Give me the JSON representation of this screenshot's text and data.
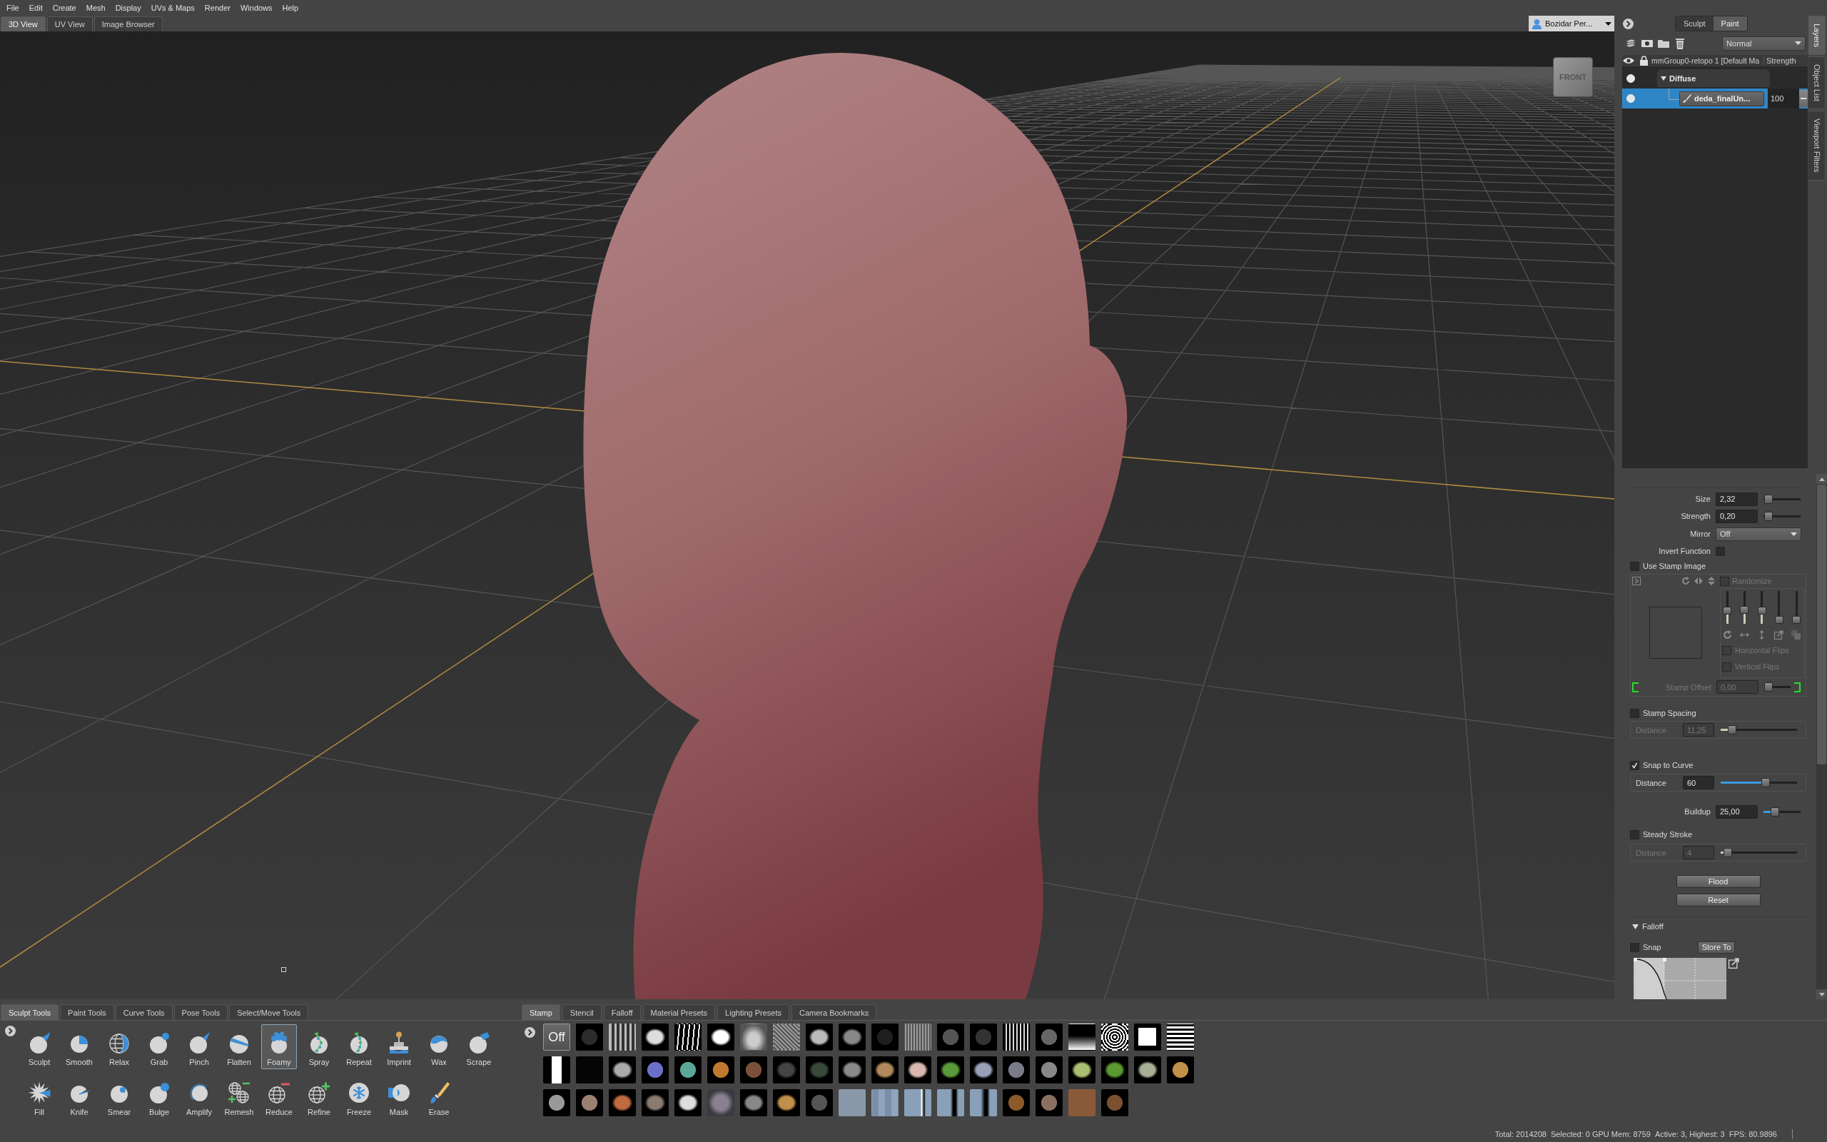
{
  "menu": [
    "File",
    "Edit",
    "Create",
    "Mesh",
    "Display",
    "UVs & Maps",
    "Render",
    "Windows",
    "Help"
  ],
  "view_tabs": [
    {
      "label": "3D View",
      "selected": true
    },
    {
      "label": "UV View",
      "selected": false
    },
    {
      "label": "Image Browser",
      "selected": false
    }
  ],
  "user_menu": {
    "label": "Bozidar Per..."
  },
  "viewport": {
    "view_cube": "FRONT"
  },
  "layers": {
    "mode_tabs": [
      {
        "label": "Sculpt",
        "selected": false
      },
      {
        "label": "Paint",
        "selected": true
      }
    ],
    "blend_mode": "Normal",
    "header": {
      "name": "mmGroup0-retopo 1 [Default Ma",
      "strength": "Strength"
    },
    "items": [
      {
        "name": "Diffuse",
        "visible": true,
        "expanded": true,
        "selected": false,
        "children": [
          {
            "name": "deda_finalUn...",
            "visible": true,
            "strength": "100",
            "selected": true
          }
        ]
      }
    ]
  },
  "side_tabs": [
    {
      "label": "Layers",
      "selected": true
    },
    {
      "label": "Object List",
      "selected": false
    },
    {
      "label": "Viewport Filters",
      "selected": false
    }
  ],
  "brush": {
    "size": {
      "label": "Size",
      "value": "2,32",
      "level": 0.02
    },
    "strength": {
      "label": "Strength",
      "value": "0,20",
      "level": 0.02
    },
    "mirror": {
      "label": "Mirror",
      "value": "Off"
    },
    "invert": {
      "label": "Invert Function",
      "checked": false
    },
    "stamp": {
      "label": "Use Stamp Image",
      "checked": false,
      "randomize": {
        "label": "Randomize",
        "checked": false
      },
      "sliders": [
        {
          "level": 0.35
        },
        {
          "level": 0.38
        },
        {
          "level": 0.36
        },
        {
          "level": 0
        },
        {
          "level": 0
        }
      ],
      "flips": [
        {
          "label": "Horizontal Flips",
          "checked": false
        },
        {
          "label": "Vertical Flips",
          "checked": false
        }
      ],
      "offset": {
        "label": "Stamp Offset",
        "value": "0,00",
        "level": 0
      }
    },
    "spacing": {
      "label": "Stamp Spacing",
      "checked": false,
      "distance": {
        "label": "Distance",
        "value": "11,25",
        "level": 0.11
      }
    },
    "snap": {
      "label": "Snap to Curve",
      "checked": true,
      "distance": {
        "label": "Distance",
        "value": "60",
        "level": 0.6
      }
    },
    "buildup": {
      "label": "Buildup",
      "value": "25,00",
      "level": 0.26
    },
    "steady": {
      "label": "Steady Stroke",
      "checked": false,
      "distance": {
        "label": "Distance",
        "value": "4",
        "level": 0.04
      }
    },
    "buttons": [
      "Flood",
      "Reset"
    ],
    "falloff": {
      "label": "Falloff",
      "expanded": true,
      "snap": {
        "label": "Snap",
        "checked": false
      },
      "store": "Store To"
    }
  },
  "tool_tabs": [
    {
      "label": "Sculpt Tools",
      "selected": true
    },
    {
      "label": "Paint Tools",
      "selected": false
    },
    {
      "label": "Curve Tools",
      "selected": false
    },
    {
      "label": "Pose Tools",
      "selected": false
    },
    {
      "label": "Select/Move Tools",
      "selected": false
    }
  ],
  "tool_rows": [
    [
      {
        "label": "Sculpt",
        "selected": false
      },
      {
        "label": "Smooth",
        "selected": false
      },
      {
        "label": "Relax",
        "selected": false
      },
      {
        "label": "Grab",
        "selected": false
      },
      {
        "label": "Pinch",
        "selected": false
      },
      {
        "label": "Flatten",
        "selected": false
      },
      {
        "label": "Foamy",
        "selected": true
      },
      {
        "label": "Spray",
        "selected": false
      },
      {
        "label": "Repeat",
        "selected": false
      },
      {
        "label": "Imprint",
        "selected": false
      },
      {
        "label": "Wax",
        "selected": false
      },
      {
        "label": "Scrape",
        "selected": false
      }
    ],
    [
      {
        "label": "Fill",
        "selected": false
      },
      {
        "label": "Knife",
        "selected": false
      },
      {
        "label": "Smear",
        "selected": false
      },
      {
        "label": "Bulge",
        "selected": false
      },
      {
        "label": "Amplify",
        "selected": false
      },
      {
        "label": "Remesh",
        "selected": false
      },
      {
        "label": "Reduce",
        "selected": false
      },
      {
        "label": "Refine",
        "selected": false
      },
      {
        "label": "Freeze",
        "selected": false
      },
      {
        "label": "Mask",
        "selected": false
      },
      {
        "label": "Erase",
        "selected": false
      }
    ]
  ],
  "tray_tabs": [
    {
      "label": "Stamp",
      "selected": true
    },
    {
      "label": "Stencil",
      "selected": false
    },
    {
      "label": "Falloff",
      "selected": false
    },
    {
      "label": "Material Presets",
      "selected": false
    },
    {
      "label": "Lighting Presets",
      "selected": false
    },
    {
      "label": "Camera Bookmarks",
      "selected": false
    }
  ],
  "stamps": [
    {
      "label": "Off",
      "selected": true
    },
    {
      "selected": false
    },
    {
      "selected": false
    },
    {
      "selected": false
    },
    {
      "selected": false
    },
    {
      "selected": false
    },
    {
      "selected": false
    },
    {
      "selected": false
    },
    {
      "selected": false
    },
    {
      "selected": false
    },
    {
      "selected": false
    },
    {
      "selected": false
    },
    {
      "selected": false
    },
    {
      "selected": false
    },
    {
      "selected": false
    },
    {
      "selected": false
    },
    {
      "selected": false
    },
    {
      "selected": false
    },
    {
      "selected": false
    },
    {
      "selected": false
    },
    {
      "selected": false
    },
    {
      "selected": false
    },
    {
      "selected": false
    },
    {
      "selected": false
    },
    {
      "selected": false
    },
    {
      "selected": false
    },
    {
      "selected": false
    },
    {
      "selected": false
    },
    {
      "selected": false
    },
    {
      "selected": false
    },
    {
      "selected": false
    },
    {
      "selected": false
    },
    {
      "selected": false
    },
    {
      "selected": false
    },
    {
      "selected": false
    },
    {
      "selected": false
    },
    {
      "selected": false
    },
    {
      "selected": false
    },
    {
      "selected": false
    },
    {
      "selected": false
    },
    {
      "selected": false
    },
    {
      "selected": false
    },
    {
      "selected": false
    },
    {
      "selected": false
    },
    {
      "selected": false
    },
    {
      "selected": false
    },
    {
      "selected": false
    },
    {
      "selected": false
    },
    {
      "selected": false
    },
    {
      "selected": false
    },
    {
      "selected": false
    },
    {
      "selected": false
    },
    {
      "selected": false
    },
    {
      "selected": false
    },
    {
      "selected": false
    },
    {
      "selected": false
    },
    {
      "selected": false
    },
    {
      "selected": false
    }
  ],
  "status": [
    "Total: 2014208",
    "Selected: 0 GPU Mem: 8759",
    "Active: 3, Highest: 3",
    "FPS: 80.9896"
  ]
}
